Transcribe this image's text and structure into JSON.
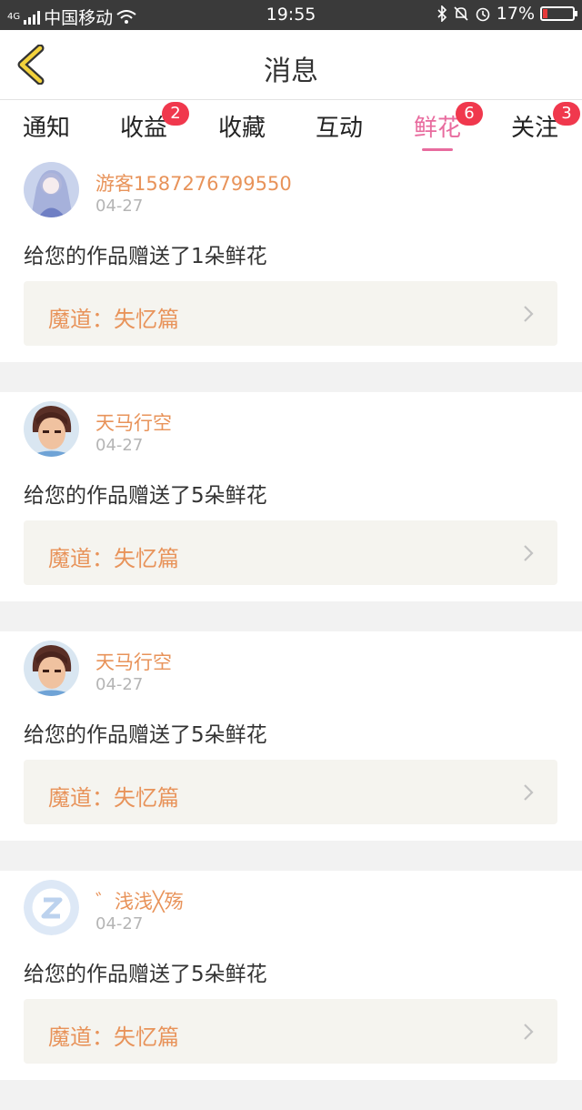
{
  "statusbar": {
    "carrier": "中国移动",
    "network": "4G",
    "time": "19:55",
    "battery": "17%",
    "battery_level": 0.17
  },
  "header": {
    "title": "消息"
  },
  "tabs": [
    {
      "label": "通知",
      "badge": ""
    },
    {
      "label": "收益",
      "badge": "2"
    },
    {
      "label": "收藏",
      "badge": ""
    },
    {
      "label": "互动",
      "badge": ""
    },
    {
      "label": "鲜花",
      "badge": "6",
      "active": true
    },
    {
      "label": "关注",
      "badge": "3"
    }
  ],
  "items": [
    {
      "user": "游客1587276799550",
      "date": "04-27",
      "message": "给您的作品赠送了1朵鲜花",
      "work": "魔道：失忆篇",
      "avatar": "anime-girl-avatar"
    },
    {
      "user": "天马行空",
      "date": "04-27",
      "message": "给您的作品赠送了5朵鲜花",
      "work": "魔道：失忆篇",
      "avatar": "anime-boy-avatar"
    },
    {
      "user": "天马行空",
      "date": "04-27",
      "message": "给您的作品赠送了5朵鲜花",
      "work": "魔道：失忆篇",
      "avatar": "anime-boy-avatar"
    },
    {
      "user": "゛浅浅╳殇",
      "date": "04-27",
      "message": "给您的作品赠送了5朵鲜花",
      "work": "魔道：失忆篇",
      "avatar": "default-avatar"
    }
  ],
  "colors": {
    "accent": "#e86b9e",
    "badge": "#f0384d",
    "name": "#e8935a",
    "statusbar": "#3a3a3a"
  }
}
